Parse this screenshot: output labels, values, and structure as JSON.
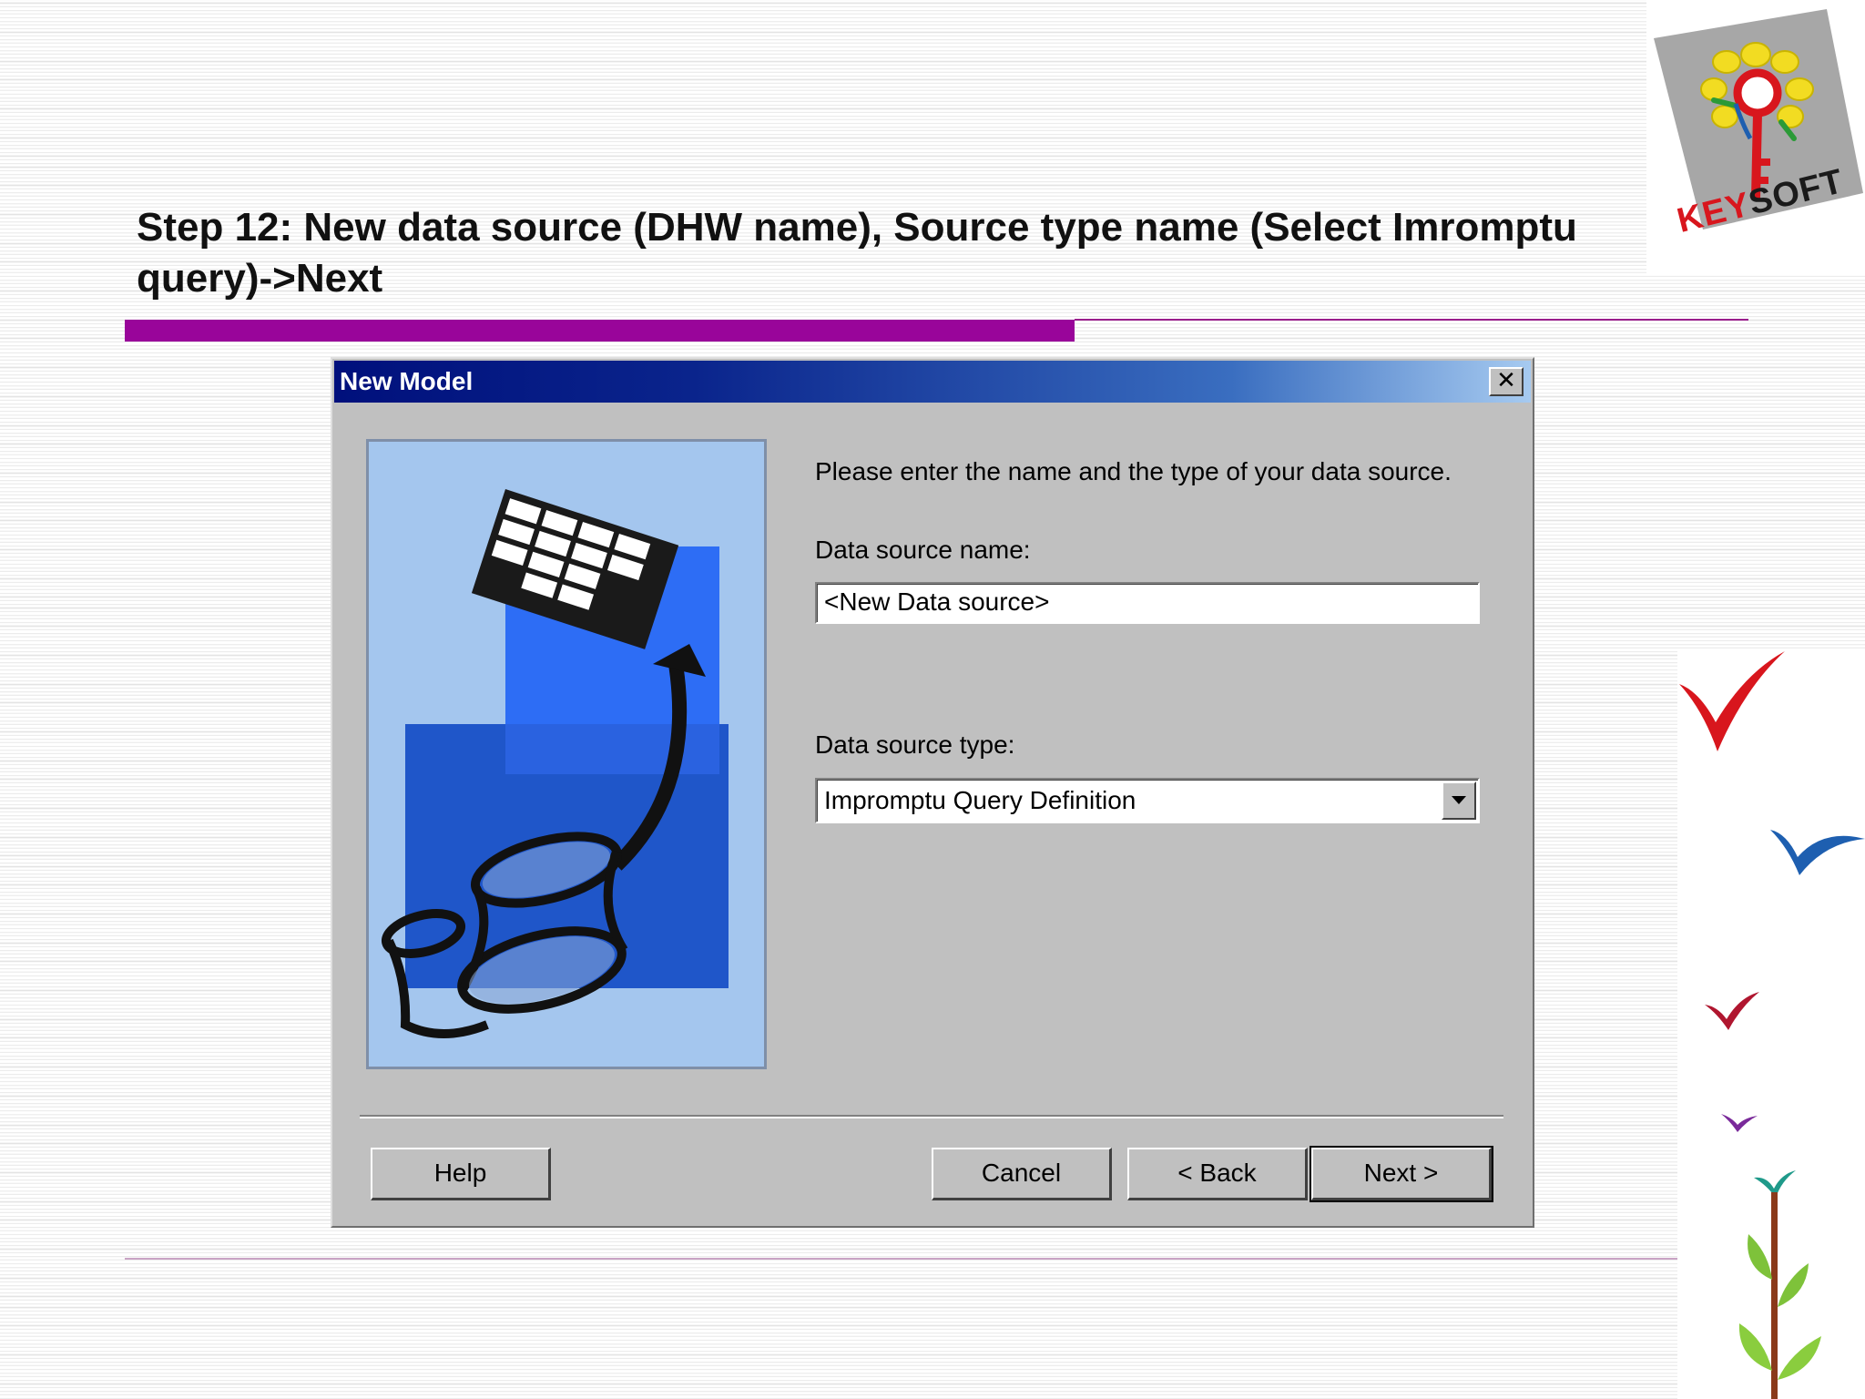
{
  "slide": {
    "title": "Step 12: New data source  (DHW name), Source type name (Select Imromptu query)->Next"
  },
  "logo": {
    "text_part1": "KEY",
    "text_part2": "SOFT"
  },
  "dialog": {
    "title": "New Model",
    "close_glyph": "✕",
    "intro_text": "Please enter the name and the type of your data source.",
    "data_source_name_label": "Data source name:",
    "data_source_name_value": "<New Data source>",
    "data_source_type_label": "Data source type:",
    "data_source_type_value": "Impromptu Query Definition",
    "buttons": {
      "help": "Help",
      "cancel": "Cancel",
      "back": "< Back",
      "next": "Next >"
    }
  },
  "colors": {
    "title_bar_start": "#00107c",
    "title_bar_end": "#a6caf0",
    "dialog_face": "#c0c0c0",
    "accent_bar": "#99059a",
    "logo_red": "#d8161d"
  },
  "icons": [
    "close-icon",
    "chevron-down-icon",
    "data-transfer-illustration",
    "checkmark-decoration",
    "plant-decoration",
    "keysoft-logo-icon"
  ]
}
